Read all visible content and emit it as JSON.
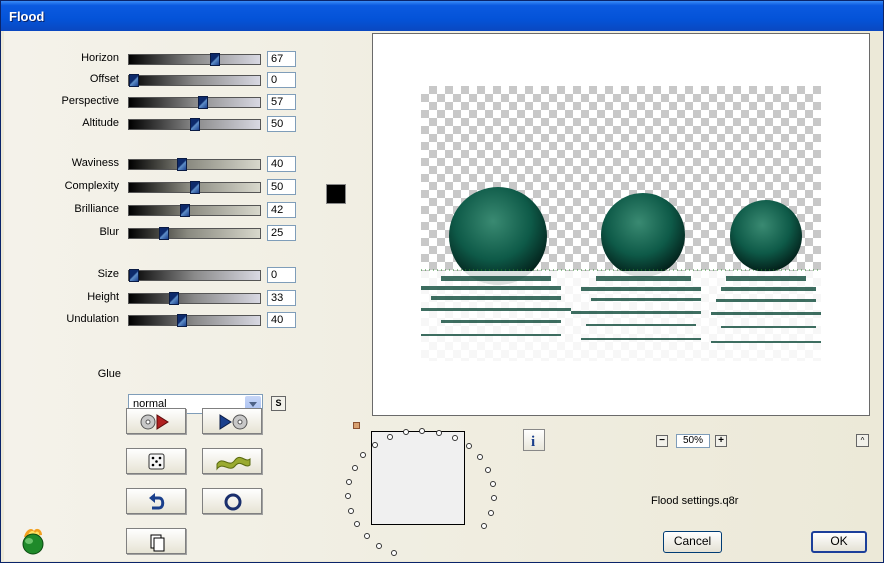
{
  "window": {
    "title": "Flood"
  },
  "sliders": [
    {
      "label": "Horizon",
      "value": "67",
      "fraction": 0.67,
      "style": "grey"
    },
    {
      "label": "Offset",
      "value": "0",
      "fraction": 0.0,
      "style": "grey"
    },
    {
      "label": "Perspective",
      "value": "57",
      "fraction": 0.57,
      "style": "grey"
    },
    {
      "label": "Altitude",
      "value": "50",
      "fraction": 0.5,
      "style": "grey"
    },
    {
      "label": "Waviness",
      "value": "40",
      "fraction": 0.4,
      "style": "tan"
    },
    {
      "label": "Complexity",
      "value": "50",
      "fraction": 0.5,
      "style": "tan"
    },
    {
      "label": "Brilliance",
      "value": "42",
      "fraction": 0.42,
      "style": "tan"
    },
    {
      "label": "Blur",
      "value": "25",
      "fraction": 0.25,
      "style": "tan"
    },
    {
      "label": "Size",
      "value": "0",
      "fraction": 0.0,
      "style": "grey"
    },
    {
      "label": "Height",
      "value": "33",
      "fraction": 0.33,
      "style": "grey"
    },
    {
      "label": "Undulation",
      "value": "40",
      "fraction": 0.4,
      "style": "grey"
    }
  ],
  "color_swatch": {
    "color": "#000000"
  },
  "glue": {
    "label": "Glue",
    "value": "normal",
    "s_button": "S"
  },
  "zoom": {
    "value": "50%",
    "minus": "−",
    "plus": "+",
    "up": "^"
  },
  "info": {
    "label": "i"
  },
  "settings_file": "Flood settings.q8r",
  "buttons": {
    "cancel": "Cancel",
    "ok": "OK"
  },
  "colors": {
    "accent_title": "#0453d8",
    "sphere": "#0e5a48",
    "thumb": "#0d2a6b"
  }
}
